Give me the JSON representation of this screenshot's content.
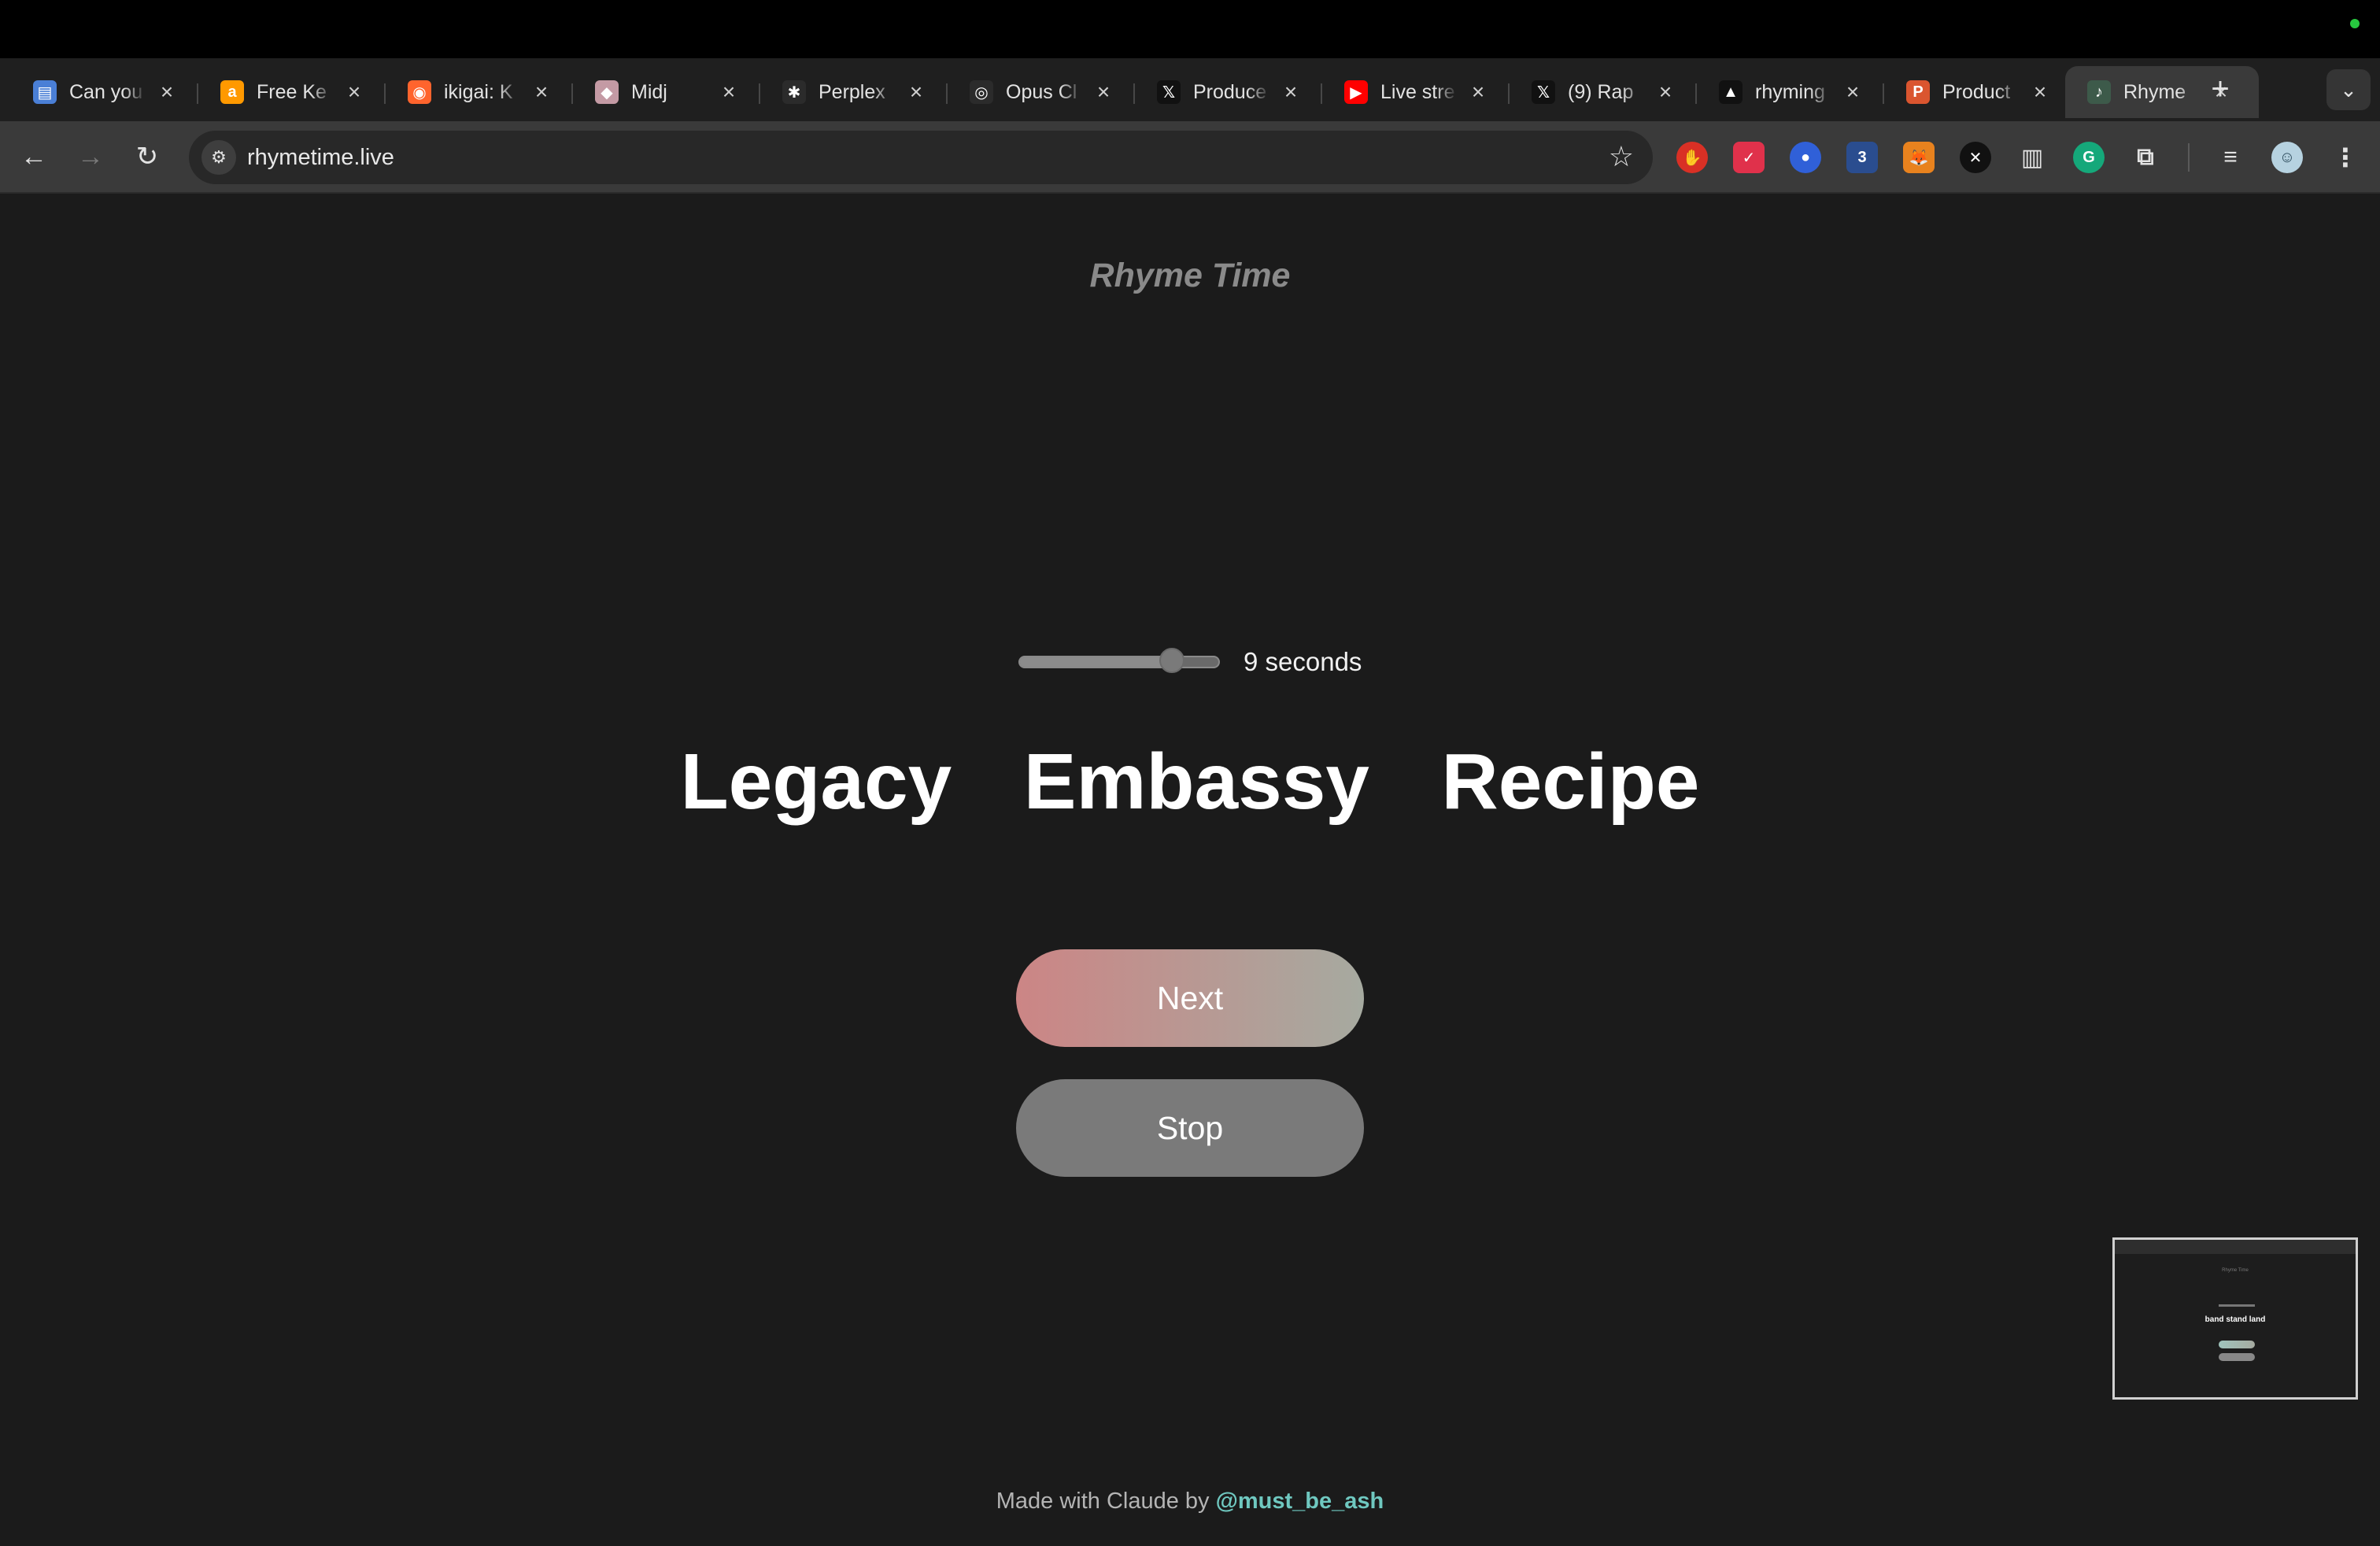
{
  "browser": {
    "tabs": [
      {
        "label": "Can you",
        "icon": "docs-icon",
        "color": "#4a7fd6"
      },
      {
        "label": "Free Ke",
        "icon": "amazon-icon",
        "color": "#ff9900"
      },
      {
        "label": "ikigai: K",
        "icon": "semrush-icon",
        "color": "#ff642d"
      },
      {
        "label": "Midj",
        "icon": "midjourney-icon",
        "color": "#c49aa4"
      },
      {
        "label": "Perplex",
        "icon": "perplexity-icon",
        "color": "#2b2b2b"
      },
      {
        "label": "Opus Cl",
        "icon": "opus-clip-icon",
        "color": "#2b2b2b"
      },
      {
        "label": "Produce",
        "icon": "x-icon",
        "color": "#111111"
      },
      {
        "label": "Live stre",
        "icon": "youtube-icon",
        "color": "#ff0000"
      },
      {
        "label": "(9) Rap",
        "icon": "x-icon",
        "color": "#111111"
      },
      {
        "label": "rhyming",
        "icon": "vercel-icon",
        "color": "#111111"
      },
      {
        "label": "Product",
        "icon": "product-hunt-icon",
        "color": "#da552f"
      },
      {
        "label": "Rhyme",
        "icon": "rhyme-time-icon",
        "color": "#3d5a4a"
      }
    ],
    "url": "rhymetime.live"
  },
  "page": {
    "brand": "Rhyme Time",
    "slider": {
      "value": 9,
      "min": 1,
      "max": 10,
      "label": "9 seconds"
    },
    "words": "Legacy  Embassy  Recipe",
    "next_label": "Next",
    "stop_label": "Stop",
    "footer_prefix": "Made with Claude by ",
    "footer_handle": "@must_be_ash"
  },
  "preview": {
    "brand": "Rhyme Time",
    "words": "band stand land"
  }
}
